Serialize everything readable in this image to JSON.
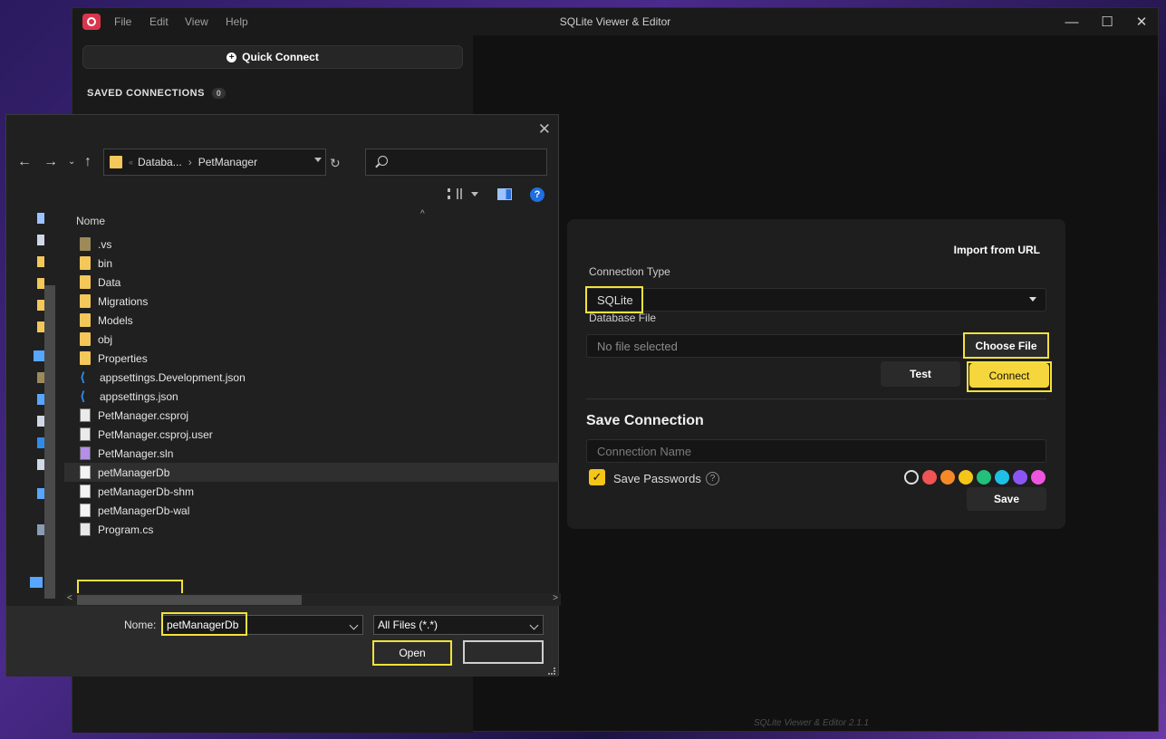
{
  "app": {
    "title": "SQLite Viewer & Editor",
    "menu": [
      "File",
      "Edit",
      "View",
      "Help"
    ],
    "version": "SQLite Viewer & Editor 2.1.1"
  },
  "sidebar": {
    "quick_connect_label": "Quick Connect",
    "saved_connections_label": "SAVED CONNECTIONS",
    "saved_count": "0"
  },
  "connection_form": {
    "import_url_label": "Import from URL",
    "connection_type_label": "Connection Type",
    "connection_type_value": "SQLite",
    "database_file_label": "Database File",
    "database_file_placeholder": "No file selected",
    "choose_file_label": "Choose File",
    "test_label": "Test",
    "connect_label": "Connect",
    "save_connection_title": "Save Connection",
    "connection_name_placeholder": "Connection Name",
    "save_passwords_label": "Save Passwords",
    "save_passwords_checked": true,
    "save_label": "Save",
    "color_swatches": [
      "#1e1e1e",
      "#f05454",
      "#f5892a",
      "#f5c518",
      "#22c07a",
      "#1ec0e6",
      "#8b55f6",
      "#ee55dd"
    ]
  },
  "file_dialog": {
    "breadcrumb": [
      "Databa...",
      "PetManager"
    ],
    "column_header": "Nome",
    "files": [
      {
        "name": ".vs",
        "icon": "folder-dim"
      },
      {
        "name": "bin",
        "icon": "folder"
      },
      {
        "name": "Data",
        "icon": "folder"
      },
      {
        "name": "Migrations",
        "icon": "folder"
      },
      {
        "name": "Models",
        "icon": "folder"
      },
      {
        "name": "obj",
        "icon": "folder"
      },
      {
        "name": "Properties",
        "icon": "folder"
      },
      {
        "name": "appsettings.Development.json",
        "icon": "vscode"
      },
      {
        "name": "appsettings.json",
        "icon": "vscode"
      },
      {
        "name": "PetManager.csproj",
        "icon": "proj"
      },
      {
        "name": "PetManager.csproj.user",
        "icon": "proj"
      },
      {
        "name": "PetManager.sln",
        "icon": "sln"
      },
      {
        "name": "petManagerDb",
        "icon": "file",
        "selected": true
      },
      {
        "name": "petManagerDb-shm",
        "icon": "file"
      },
      {
        "name": "petManagerDb-wal",
        "icon": "file"
      },
      {
        "name": "Program.cs",
        "icon": "cs"
      }
    ],
    "filename_label": "Nome:",
    "filename_value": "petManagerDb",
    "file_type_value": "All Files (*.*)",
    "open_label": "Open",
    "cancel_label": ""
  }
}
